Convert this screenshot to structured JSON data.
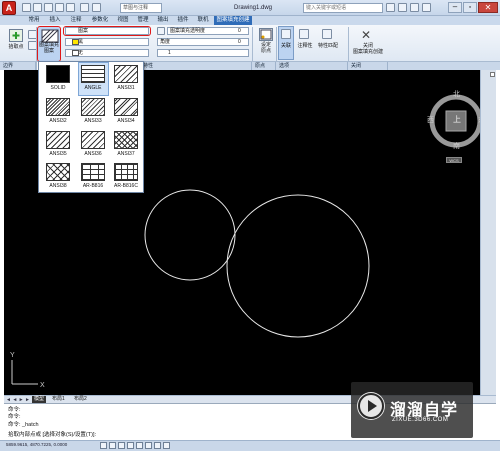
{
  "titlebar": {
    "workspace": "草图与注释",
    "document": "Drawing1.dwg",
    "search_placeholder": "键入关键字或短语"
  },
  "ribbon_tabs": [
    "常用",
    "插入",
    "注释",
    "参数化",
    "视图",
    "管理",
    "输出",
    "插件",
    "联机",
    "图案填充创建"
  ],
  "ribbon": {
    "pick_points_label": "拾取点",
    "hatch_pattern_label": "图案填充\n图案",
    "type_value": "图案",
    "color_value": "黑",
    "bg_value": "无",
    "transparency_label": "图案填充透明度",
    "transparency_value": "0",
    "angle_label": "角度",
    "angle_value": "0",
    "scale_value": "1",
    "set_origin_label": "设定\n原点",
    "associative_label": "关联",
    "annotative_label": "注释性",
    "match_label": "特性匹配",
    "close_label": "关闭\n图案填充创建",
    "panels": {
      "boundary": "边界",
      "properties": "特性",
      "origin": "原点",
      "options": "选项",
      "close": "关闭"
    }
  },
  "hatch_patterns": [
    "SOLID",
    "ANGLE",
    "ANSI31",
    "ANSI32",
    "ANSI33",
    "ANSI34",
    "ANSI35",
    "ANSI36",
    "ANSI37",
    "ANSI38",
    "AR-B816",
    "AR-B816C"
  ],
  "viewcube": {
    "north": "北",
    "south": "南",
    "east": "东",
    "west": "西",
    "top": "上",
    "wcs": "WCS"
  },
  "layout_tabs": [
    "模型",
    "布局1",
    "布局2"
  ],
  "command_lines": [
    "命令:",
    "命令:",
    "命令: _hatch",
    "拾取内部点或 [选择对象(S)/设置(T)]:"
  ],
  "status": {
    "coords": "5859.9615,  4870.7225, 0.0000"
  },
  "watermark": {
    "brand": "溜溜自学",
    "url": "ZIXUE.3D66.COM"
  },
  "colors": {
    "accent": "#2f6cb8",
    "canvas": "#000000",
    "highlight": "#e01818"
  }
}
